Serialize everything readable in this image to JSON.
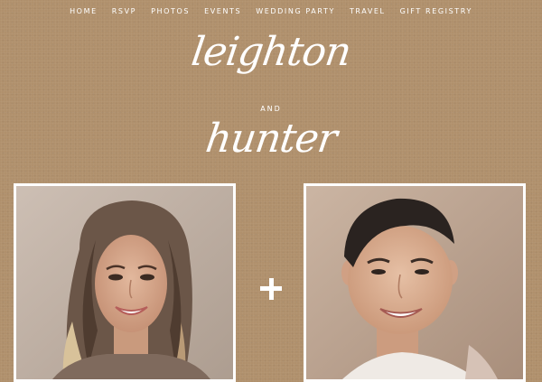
{
  "nav": {
    "items": [
      "HOME",
      "RSVP",
      "PHOTOS",
      "EVENTS",
      "WEDDING PARTY",
      "TRAVEL",
      "GIFT REGISTRY"
    ]
  },
  "header": {
    "first_name": "leighton",
    "conjunction": "AND",
    "second_name": "hunter"
  },
  "divider_symbol": "+",
  "colors": {
    "background": "#b0906c",
    "text": "#ffffff"
  }
}
